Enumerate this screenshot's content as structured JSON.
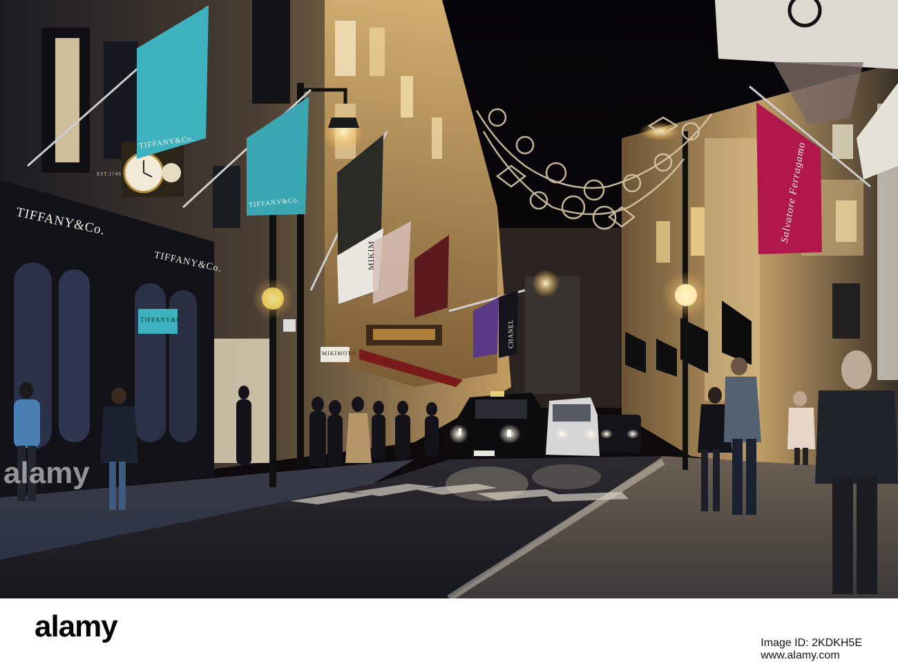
{
  "photo": {
    "signs": {
      "tiffany_flag": "TIFFANY&Co.",
      "tiffany_flag_2": "TIFFANY&Co.",
      "tiffany_store": "TIFFANY&Co.",
      "tiffany_store_2": "TIFFANY&Co.",
      "tiffany_sign_small": "TIFFANY&Co.",
      "mikimoto_sign": "MIKIMOTO",
      "mikimoto_banner": "MIKIM",
      "chanel_banner": "CHANEL",
      "ferragamo_banner": "Salvatore Ferragamo",
      "clock_est": "EST.1749"
    },
    "watermark": "alamy"
  },
  "footer": {
    "logo": "alamy",
    "image_id": "Image ID: 2KDKH5E",
    "site": "www.alamy.com"
  },
  "colors": {
    "sky": "#07060a",
    "facade_warm": "#c9a66a",
    "tiffany_blue": "#3fb2bf",
    "ferragamo_red": "#b0174a",
    "street": "#1c1d24"
  }
}
